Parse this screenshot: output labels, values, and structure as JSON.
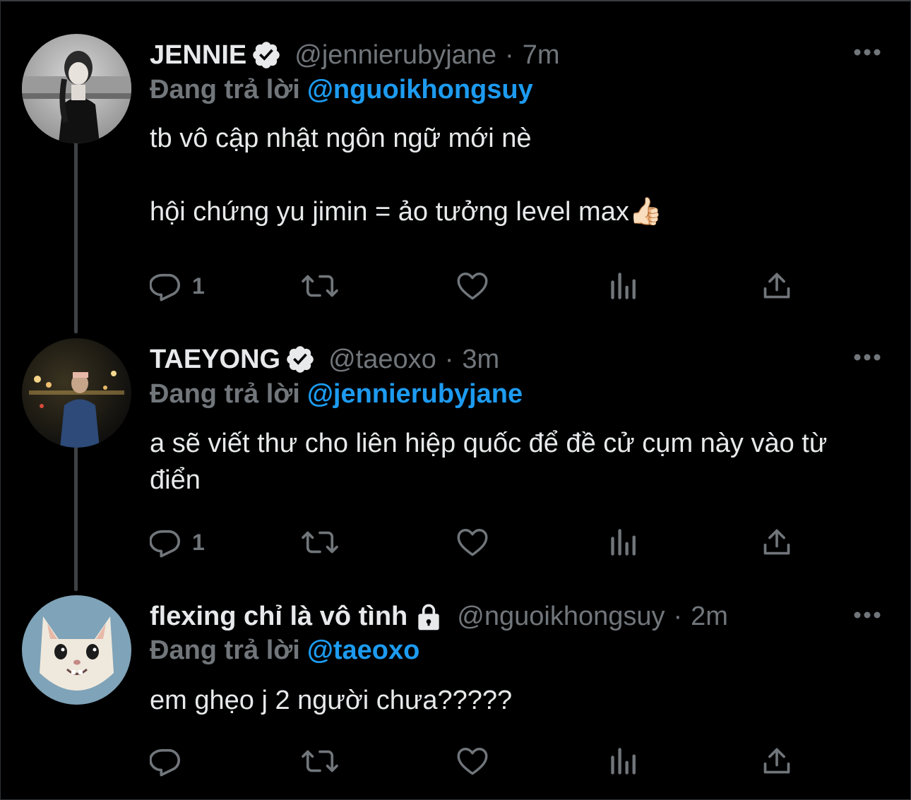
{
  "tweets": [
    {
      "display_name": "JENNIE",
      "badge": "verified-badge-icon",
      "handle": "@jennierubyjane",
      "separator": "·",
      "time": "7m",
      "reply_label": "Đang trả lời",
      "reply_to": "@nguoikhongsuy",
      "text": "tb vô cập nhật ngôn ngữ mới nè\n\nhội chứng yu jimin = ảo tưởng level max👍🏻",
      "reply_count": "1",
      "retweet_count": "",
      "like_count": ""
    },
    {
      "display_name": "TAEYONG",
      "badge": "verified-badge-icon",
      "handle": "@taeoxo",
      "separator": "·",
      "time": "3m",
      "reply_label": "Đang trả lời",
      "reply_to": "@jennierubyjane",
      "text": "a sẽ viết thư cho liên hiệp quốc để đề cử cụm này vào từ điển",
      "reply_count": "1",
      "retweet_count": "",
      "like_count": ""
    },
    {
      "display_name": "flexing chỉ là vô tình",
      "badge": "lock-icon",
      "handle": "@nguoikhongsuy",
      "separator": "·",
      "time": "2m",
      "reply_label": "Đang trả lời",
      "reply_to": "@taeoxo",
      "text": "em ghẹo j 2 người chưa?????",
      "reply_count": "",
      "retweet_count": "",
      "like_count": ""
    }
  ],
  "colors": {
    "background": "#000000",
    "text": "#e7e9ea",
    "muted": "#71767b",
    "link": "#1d9bf0",
    "thread_line": "#3e4144"
  },
  "icons": [
    "reply-icon",
    "retweet-icon",
    "like-icon",
    "views-icon",
    "share-icon",
    "more-icon"
  ]
}
